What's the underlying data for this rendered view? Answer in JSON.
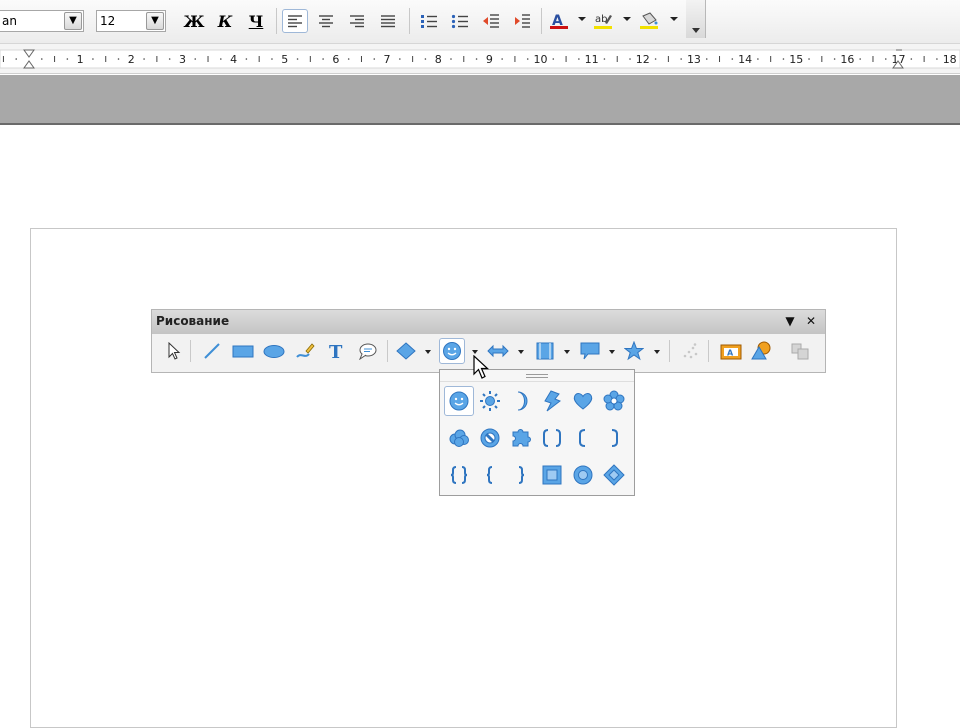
{
  "format_toolbar": {
    "font_name": "an",
    "font_size": "12",
    "bold_label": "Ж",
    "italic_label": "К",
    "underline_label": "Ч"
  },
  "ruler": {
    "numbers": [
      "1",
      "2",
      "3",
      "4",
      "5",
      "6",
      "7",
      "8",
      "9",
      "10",
      "11",
      "12",
      "13",
      "14",
      "15",
      "16",
      "17",
      "18"
    ]
  },
  "drawing_toolbar": {
    "title": "Рисование"
  },
  "icons": {
    "accent": "#3f8fd6",
    "font_color": "#cc1111",
    "highlight": "#f2e100"
  }
}
